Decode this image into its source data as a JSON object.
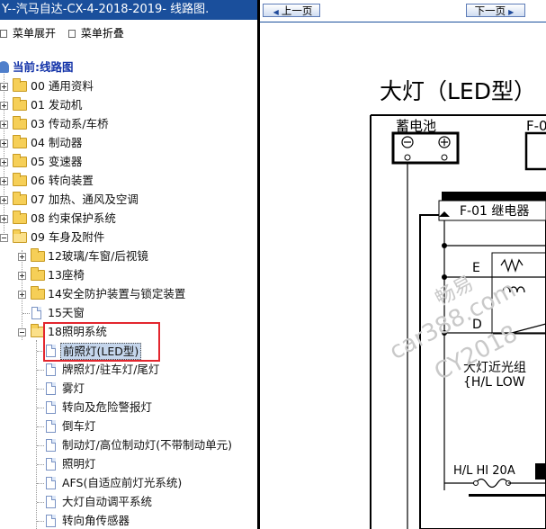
{
  "window": {
    "title": "Y--汽马自达-CX-4-2018-2019- 线路图."
  },
  "menu": {
    "expand_label": "菜单展开",
    "collapse_label": "菜单折叠"
  },
  "tree": {
    "root_label": "当前:线路图",
    "items": [
      {
        "label": "00 通用资料"
      },
      {
        "label": "01 发动机"
      },
      {
        "label": "03 传动系/车桥"
      },
      {
        "label": "04 制动器"
      },
      {
        "label": "05 变速器"
      },
      {
        "label": "06 转向装置"
      },
      {
        "label": "07 加热、通风及空调"
      },
      {
        "label": "08 约束保护系统"
      },
      {
        "label": "09 车身及附件"
      }
    ],
    "sub_items": [
      {
        "label": "12玻璃/车窗/后视镜"
      },
      {
        "label": "13座椅"
      },
      {
        "label": "14安全防护装置与锁定装置"
      },
      {
        "label": "15天窗"
      },
      {
        "label": "18照明系统"
      }
    ],
    "lighting_items": [
      {
        "label": "前照灯(LED型)"
      },
      {
        "label": "牌照灯/驻车灯/尾灯"
      },
      {
        "label": "雾灯"
      },
      {
        "label": "转向及危险警报灯"
      },
      {
        "label": "倒车灯"
      },
      {
        "label": "制动灯/高位制动灯(不带制动单元)"
      },
      {
        "label": "照明灯"
      },
      {
        "label": "AFS(自适应前灯光系统)"
      },
      {
        "label": "大灯自动调平系统"
      },
      {
        "label": "转向角传感器"
      }
    ]
  },
  "nav": {
    "prev_label": "上一页",
    "next_label": "下一页"
  },
  "diagram": {
    "title": "大灯（LED型）",
    "battery_label": "蓄电池",
    "fuse_box_partial": "F-0",
    "relay_label": "F-01  继电器",
    "terminal_e": "E",
    "terminal_d": "D",
    "lowbeam_label_1": "大灯近光组",
    "lowbeam_label_2": "{H/L LOW",
    "fuse_label": "H/L HI 20A",
    "watermark_1": "畅易",
    "watermark_2": "car388.com",
    "watermark_3": "CY2018"
  },
  "colors": {
    "titlebar_bg": "#1a4f9c",
    "highlight_box": "#e3262e",
    "selection_bg": "#c5d6ec"
  }
}
